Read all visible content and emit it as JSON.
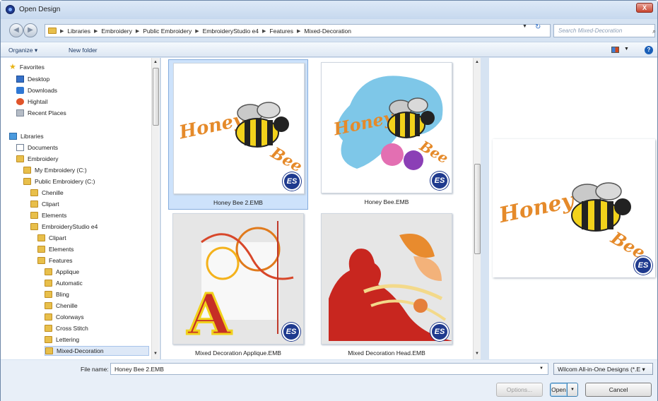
{
  "window": {
    "title": "Open Design",
    "close_label": "X"
  },
  "breadcrumb": [
    "Libraries",
    "Embroidery",
    "Public Embroidery",
    "EmbroideryStudio e4",
    "Features",
    "Mixed-Decoration"
  ],
  "search": {
    "placeholder": "Search Mixed-Decoration"
  },
  "toolbar": {
    "organize": "Organize ▾",
    "new_folder": "New folder"
  },
  "nav_tree": {
    "favorites": "Favorites",
    "desktop": "Desktop",
    "downloads": "Downloads",
    "hightail": "Hightail",
    "recent_places": "Recent Places",
    "libraries": "Libraries",
    "documents": "Documents",
    "embroidery": "Embroidery",
    "my_embroidery": "My Embroidery (C:)",
    "public_embroidery": "Public Embroidery (C:)",
    "chenille": "Chenille",
    "clipart": "Clipart",
    "elements": "Elements",
    "studio": "EmbroideryStudio e4",
    "studio_clipart": "Clipart",
    "studio_elements": "Elements",
    "features": "Features",
    "applique": "Applique",
    "automatic": "Automatic",
    "bling": "Bling",
    "f_chenille": "Chenille",
    "colorways": "Colorways",
    "cross_stitch": "Cross Stitch",
    "lettering": "Lettering",
    "mixed_decoration": "Mixed-Decoration"
  },
  "files": [
    {
      "name": "Honey Bee 2.EMB",
      "badge": "ES"
    },
    {
      "name": "Honey Bee.EMB",
      "badge": "ES"
    },
    {
      "name": "Mixed Decoration Applique.EMB",
      "badge": "ES"
    },
    {
      "name": "Mixed Decoration Head.EMB",
      "badge": "ES"
    }
  ],
  "design_text": {
    "honey": "Honey",
    "bee": "Bee",
    "letter": "A"
  },
  "bottom": {
    "file_name_label": "File name:",
    "file_name_value": "Honey Bee 2.EMB",
    "file_type": "Wilcom All-in-One Designs (*.E ▾",
    "options": "Options...",
    "open": "Open",
    "cancel": "Cancel"
  },
  "colors": {
    "accent": "#1f3a8e",
    "selection": "#cde2fb",
    "thread_orange": "#e58a2a"
  }
}
